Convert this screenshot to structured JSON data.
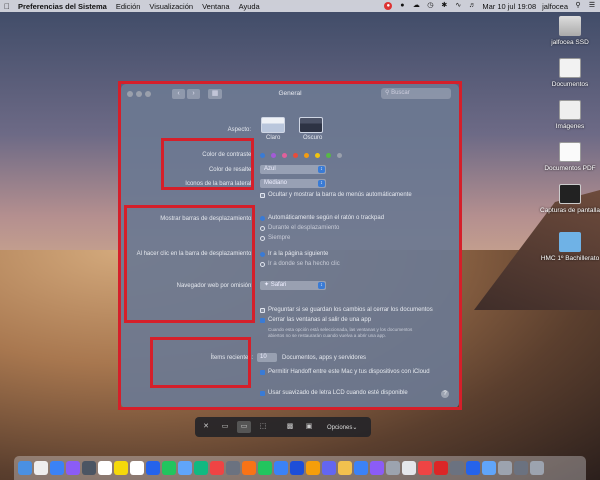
{
  "menubar": {
    "app_name": "Preferencias del Sistema",
    "menus": [
      "Edición",
      "Visualización",
      "Ventana",
      "Ayuda"
    ],
    "datetime": "Mar 10 jul  19:08",
    "user": "jalfocea"
  },
  "desktop_icons": [
    {
      "label": "jalfocea SSD",
      "icon": "drive-icon"
    },
    {
      "label": "Documentos",
      "icon": "document-icon"
    },
    {
      "label": "Imágenes",
      "icon": "image-icon"
    },
    {
      "label": "Documentos PDF",
      "icon": "pdf-icon"
    },
    {
      "label": "Capturas de pantalla",
      "icon": "screenshot-icon"
    },
    {
      "label": "HMC 1º Bachillerato",
      "icon": "folder-icon"
    }
  ],
  "window": {
    "title": "General",
    "search_placeholder": "Buscar",
    "appearance_label": "Aspecto:",
    "appearance_options": [
      "Claro",
      "Oscuro"
    ],
    "accent_label": "Color de contraste:",
    "accent_colors": [
      "#3a7bd5",
      "#a35bd6",
      "#e0609b",
      "#e74c3c",
      "#f39c12",
      "#f1c40f",
      "#57b846",
      "#9aa0ac"
    ],
    "highlight_label": "Color de resalte:",
    "highlight_value": "Azul",
    "sidebar_label": "Iconos de la barra lateral:",
    "sidebar_value": "Mediano",
    "autohide_label": "Ocultar y mostrar la barra de menús automáticamente",
    "scrollbars_label": "Mostrar barras de desplazamiento:",
    "scroll_options": [
      "Automáticamente según el ratón o trackpad",
      "Durante el desplazamiento",
      "Siempre"
    ],
    "click_label": "Al hacer clic en la barra de desplazamiento:",
    "click_options": [
      "Ir a la página siguiente",
      "Ir a donde se ha hecho clic"
    ],
    "browser_label": "Navegador web por omisión:",
    "browser_value": "Safari",
    "ask_save_label": "Preguntar si se guardan los cambios al cerrar los documentos",
    "close_windows_label": "Cerrar las ventanas al salir de una app",
    "close_windows_note": "Cuando esta opción está seleccionada, las ventanas y los documentos abiertos no se restaurarán cuando vuelva a abrir una app.",
    "recent_label": "Ítems recientes:",
    "recent_value": "10",
    "recent_suffix": "Documentos, apps y servidores",
    "handoff_label": "Permitir Handoff entre este Mac y tus dispositivos con iCloud",
    "lcd_label": "Usar suavizado de letra LCD cuando esté disponible",
    "help": "?"
  },
  "screenshot_toolbar": {
    "options_label": "Opciones",
    "chevron": "⌄"
  },
  "dock": {
    "icon_colors": [
      "#4a90e2",
      "#eeeeee",
      "#3b82f6",
      "#8b5cf6",
      "#4b5563",
      "#ffffff",
      "#f5d90a",
      "#ffffff",
      "#2563eb",
      "#22c55e",
      "#60a5fa",
      "#10b981",
      "#ef4444",
      "#6b7280",
      "#f97316",
      "#22c55e",
      "#3b82f6",
      "#1d4ed8",
      "#f59e0b",
      "#6366f1",
      "#f2c14e",
      "#3b82f6",
      "#8b5cf6",
      "#9ca3af",
      "#e5e7eb",
      "#ef4444",
      "#dc2626",
      "#6b7280",
      "#2563eb",
      "#60a5fa",
      "#9ca3af",
      "#6b7280",
      "#9ca3af"
    ]
  }
}
